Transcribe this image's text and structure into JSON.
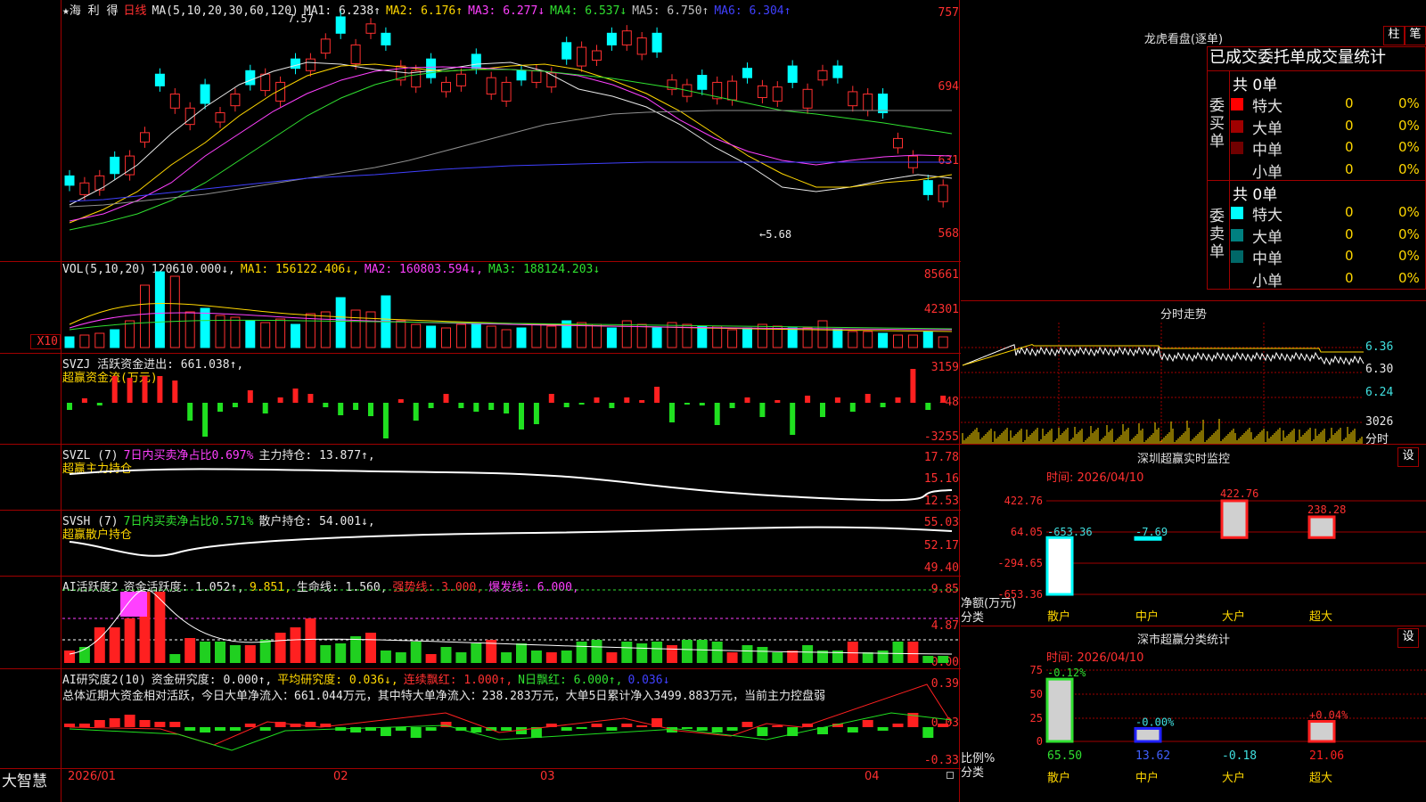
{
  "stock": {
    "name": "★海 利 得",
    "period": "日线",
    "ma_label": "MA(5,10,20,30,60,120)",
    "ma_values": [
      {
        "label": "MA1:",
        "value": "6.238↑",
        "color": "#e8e8e8"
      },
      {
        "label": "MA2:",
        "value": "6.176↑",
        "color": "#ffd700"
      },
      {
        "label": "MA3:",
        "value": "6.277↓",
        "color": "#ff40ff"
      },
      {
        "label": "MA4:",
        "value": "6.537↓",
        "color": "#30e030"
      },
      {
        "label": "MA5:",
        "value": "6.750↑",
        "color": "#c0c0c0"
      },
      {
        "label": "MA6:",
        "value": "6.304↑",
        "color": "#4040ff"
      }
    ],
    "price_axis": [
      "757",
      "694",
      "631",
      "568"
    ],
    "high_label": "7.57",
    "low_label": "←5.68"
  },
  "vol": {
    "title": "VOL(5,10,20)",
    "value": "120610.000↓,",
    "ma1": "MA1: 156122.406↓,",
    "ma2": "MA2: 160803.594↓,",
    "ma3": "MA3: 188124.203↓",
    "axis": [
      "85661",
      "42301",
      "X10"
    ]
  },
  "svzj": {
    "title": "SVZJ  活跃资金进出: 661.038↑,",
    "subtitle": "超赢资金流(万元)",
    "axis": [
      "3159",
      "-48",
      "-3255"
    ]
  },
  "svzl": {
    "title": "SVZL (7)",
    "ratio": "7日内买卖净占比0.697%",
    "hold": "主力持仓: 13.877↑,",
    "subtitle": "超赢主力持仓",
    "axis": [
      "17.78",
      "15.16",
      "12.53"
    ]
  },
  "svsh": {
    "title": "SVSH (7)",
    "ratio": "7日内买卖净占比0.571%",
    "hold": "散户持仓: 54.001↓,",
    "subtitle": "超赢散户持仓",
    "axis": [
      "55.03",
      "52.17",
      "49.40"
    ]
  },
  "ai_active": {
    "title": "AI活跃度2",
    "v1": "资金活跃度: 1.052↑,",
    "v2": "9.851,",
    "v3": "生命线: 1.560,",
    "v4": "强势线: 3.000,",
    "v5": "爆发线: 6.000,",
    "axis": [
      "9.85",
      "4.87",
      "0.00"
    ]
  },
  "ai_research": {
    "title": "AI研究度2(10)",
    "v1": "资金研究度: 0.000↑,",
    "v2": "平均研究度: 0.036↓,",
    "v3": "连续飘红: 1.000↑,",
    "v4": "N日飘红: 6.000↑,",
    "v5": "0.036↓",
    "summary": "总体近期大资金相对活跃，今日大单净流入：661.044万元，其中特大单净流入：238.283万元，大单5日累计净入3499.883万元，当前主力控盘弱",
    "axis": [
      "0.39",
      "0.03",
      "-0.33"
    ]
  },
  "dates": [
    "2026/01",
    "02",
    "03",
    "04"
  ],
  "brand": "大智慧",
  "right": {
    "dragon_title": "龙虎看盘(逐单)",
    "btn_zhu": "柱",
    "btn_bi": "笔",
    "stats_header": "已成交委托单成交量统计",
    "buy_label": "委买单",
    "sell_label": "委卖单",
    "buy_total": "共 0单",
    "sell_total": "共 0单",
    "buy_rows": [
      {
        "name": "特大",
        "count": "0",
        "pct": "0%",
        "color": "#ff0000"
      },
      {
        "name": "大单",
        "count": "0",
        "pct": "0%",
        "color": "#a00000"
      },
      {
        "name": "中单",
        "count": "0",
        "pct": "0%",
        "color": "#700000"
      },
      {
        "name": "小单",
        "count": "0",
        "pct": "0%",
        "color": "#000000"
      }
    ],
    "sell_rows": [
      {
        "name": "特大",
        "count": "0",
        "pct": "0%",
        "color": "#00ffff"
      },
      {
        "name": "大单",
        "count": "0",
        "pct": "0%",
        "color": "#008080"
      },
      {
        "name": "中单",
        "count": "0",
        "pct": "0%",
        "color": "#006868"
      },
      {
        "name": "小单",
        "count": "0",
        "pct": "0%",
        "color": "#000000"
      }
    ],
    "intraday_title": "分时走势",
    "intraday_axis": [
      "6.36",
      "6.30",
      "6.24",
      "3026",
      "分时"
    ],
    "sz_monitor_title": "深圳超赢实时监控",
    "sz_set": "设",
    "sz_time": "时间: 2026/04/10",
    "sz_axis": [
      "422.76",
      "64.05",
      "-294.65",
      "-653.36"
    ],
    "sz_unit": "净额(万元)",
    "sz_cat": "分类",
    "sz_bars": [
      {
        "name": "散户",
        "value": -653.36,
        "label": "-653.36"
      },
      {
        "name": "中户",
        "value": -7.69,
        "label": "-7.69"
      },
      {
        "name": "大户",
        "value": 422.76,
        "label": "422.76"
      },
      {
        "name": "超大",
        "value": 238.28,
        "label": "238.28"
      }
    ],
    "sc_title": "深市超赢分类统计",
    "sc_set": "设",
    "sc_time": "时间: 2026/04/10",
    "sc_axis": [
      "75",
      "50",
      "25",
      "0"
    ],
    "sc_unit": "比例%",
    "sc_cat": "分类",
    "sc_bars": [
      {
        "name": "散户",
        "value": 65.5,
        "top": "-0.12%",
        "bottom": "65.50"
      },
      {
        "name": "中户",
        "value": 13.62,
        "top": "-0.00%",
        "bottom": "13.62"
      },
      {
        "name": "大户",
        "value": -0.18,
        "top": "",
        "bottom": "-0.18"
      },
      {
        "name": "超大",
        "value": 21.06,
        "top": "+0.04%",
        "bottom": "21.06"
      }
    ]
  },
  "chart_data": {
    "type": "candlestick",
    "note_values": {
      "high": 7.57,
      "low": 5.68
    },
    "sz_monitor": {
      "type": "bar",
      "categories": [
        "散户",
        "中户",
        "大户",
        "超大"
      ],
      "values": [
        -653.36,
        -7.69,
        422.76,
        238.28
      ],
      "ylabel": "净额(万元)"
    },
    "sz_classification": {
      "type": "bar",
      "categories": [
        "散户",
        "中户",
        "大户",
        "超大"
      ],
      "values": [
        65.5,
        13.62,
        -0.18,
        21.06
      ],
      "ylabel": "比例%",
      "ylim": [
        0,
        75
      ]
    }
  }
}
